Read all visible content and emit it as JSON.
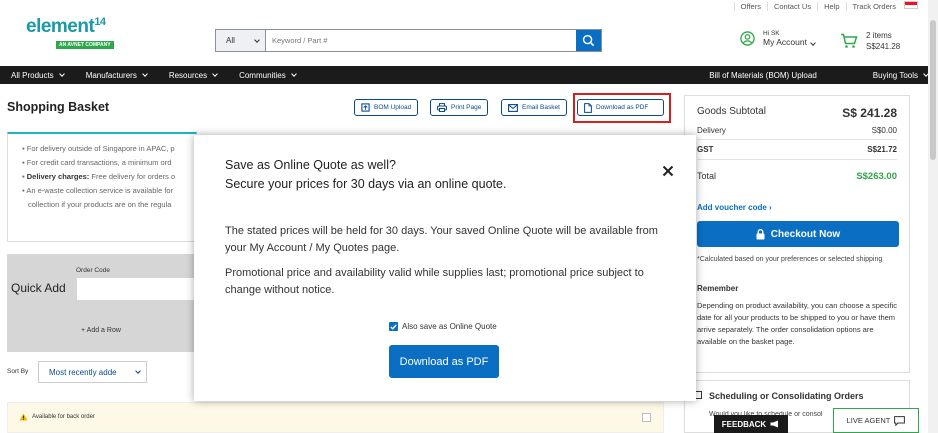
{
  "utility": {
    "links": [
      "Offers",
      "Contact Us",
      "Help",
      "Track Orders"
    ]
  },
  "header": {
    "logo_text": "element",
    "logo_super": "14",
    "logo_tagline": "AN AVNET COMPANY",
    "search_category": "All",
    "search_placeholder": "Keyword / Part #",
    "greeting": "Hi SK",
    "account_label": "My Account",
    "cart_items": "2 items",
    "cart_total": "S$241.28"
  },
  "nav": {
    "items": [
      "All Products",
      "Manufacturers",
      "Resources",
      "Communities"
    ],
    "bom_upload": "Bill of Materials (BOM) Upload",
    "buying_tools": "Buying Tools"
  },
  "page": {
    "title": "Shopping Basket",
    "toolbar": {
      "bom_upload": "BOM Upload",
      "print_page": "Print Page",
      "email_basket": "Email Basket",
      "download_pdf": "Download as PDF"
    }
  },
  "info": {
    "lines": [
      "For delivery outside of Singapore in APAC, p",
      "For credit card transactions, a minimum ord",
      "Delivery charges: Free delivery for orders o",
      "An e-waste collection service is available for",
      "collection if your products are on the regula"
    ],
    "delivery_bold": "Delivery charges:"
  },
  "quick_add": {
    "label": "Quick Add",
    "order_code_label": "Order Code",
    "add_row": "+ Add a Row"
  },
  "sort": {
    "label": "Sort By",
    "value": "Most recently adde"
  },
  "backorder": {
    "label": "Available for back order"
  },
  "summary": {
    "goods_subtotal_label": "Goods Subtotal",
    "goods_subtotal_value": "S$ 241.28",
    "delivery_label": "Delivery",
    "delivery_value": "S$0.00",
    "gst_label": "GST",
    "gst_value": "S$21.72",
    "total_label": "Total",
    "total_value": "S$263.00",
    "voucher_link": "Add voucher code",
    "checkout_label": "Checkout Now",
    "note": "*Calculated based on your preferences or selected shipping",
    "remember_title": "Remember",
    "remember_text": "Depending on product availability, you can choose a specific date for all your products to be shipped to you or have them arrive separately. The order consolidation options are available on the basket page.",
    "scheduling_title": "Scheduling or Consolidating Orders",
    "scheduling_sub": "Would you like to schedule or consol"
  },
  "modal": {
    "title": "Save as Online Quote as well?",
    "subtitle": "Secure your prices for 30 days via an online quote.",
    "para1": "The stated prices will be held for 30 days. Your saved Online Quote will be available from your My Account / My Quotes page.",
    "para2": "Promotional price and availability valid while supplies last; promotional price subject to change without notice.",
    "checkbox_label": "Also save as Online Quote",
    "checkbox_checked": true,
    "download_button": "Download as PDF"
  },
  "widgets": {
    "feedback": "FEEDBACK",
    "live_agent": "LIVE AGENT"
  },
  "colors": {
    "brand_teal": "#1a9aa5",
    "brand_green": "#2ea84a",
    "primary_blue": "#0a6fc2",
    "navy": "#0a4a8c",
    "nav_bg": "#1b1b1b",
    "total_green": "#2ea84a",
    "highlight_red": "#d62020"
  }
}
